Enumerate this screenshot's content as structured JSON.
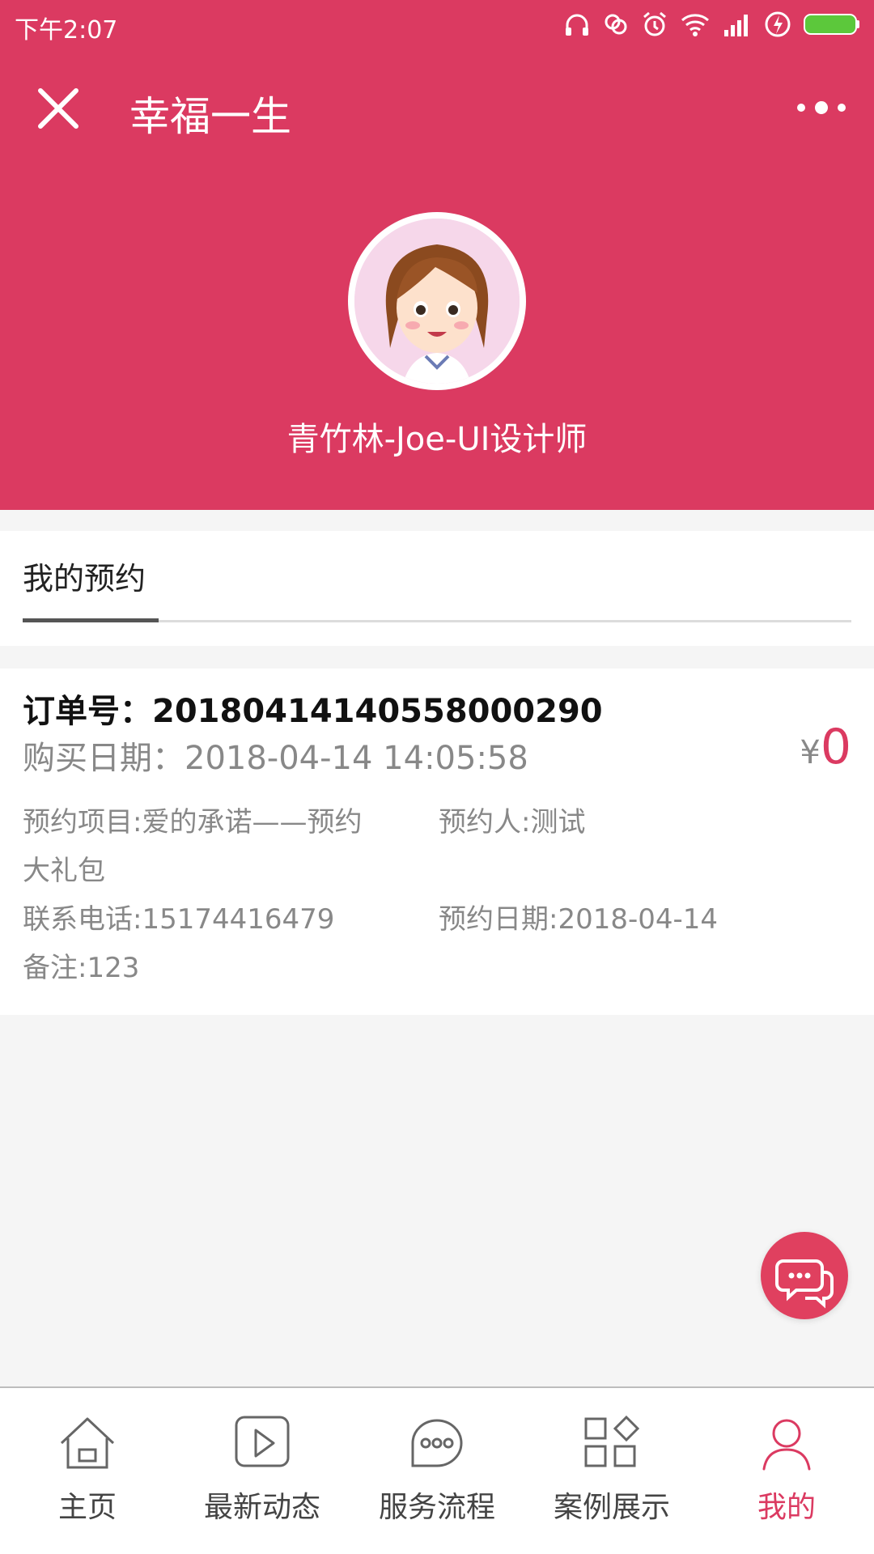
{
  "status_bar": {
    "time": "下午2:07"
  },
  "header": {
    "title": "幸福一生",
    "user_name": "青竹林-Joe-UI设计师"
  },
  "tab": {
    "label": "我的预约"
  },
  "order": {
    "order_no": "订单号：20180414140558000290",
    "buy_date": "购买日期：2018-04-14 14:05:58",
    "currency": "¥",
    "amount": "0",
    "project_line1": "预约项目:爱的承诺——预约",
    "project_line2": "大礼包",
    "person": "预约人:测试",
    "phone": "联系电话:15174416479",
    "date": "预约日期:2018-04-14",
    "note": "备注:123"
  },
  "nav": {
    "items": [
      {
        "label": "主页",
        "icon": "home-icon"
      },
      {
        "label": "最新动态",
        "icon": "play-icon"
      },
      {
        "label": "服务流程",
        "icon": "service-icon"
      },
      {
        "label": "案例展示",
        "icon": "grid-icon"
      },
      {
        "label": "我的",
        "icon": "user-icon",
        "active": true
      }
    ]
  },
  "colors": {
    "accent": "#db3a61",
    "background": "#f5f5f5",
    "text_muted": "#888888"
  }
}
